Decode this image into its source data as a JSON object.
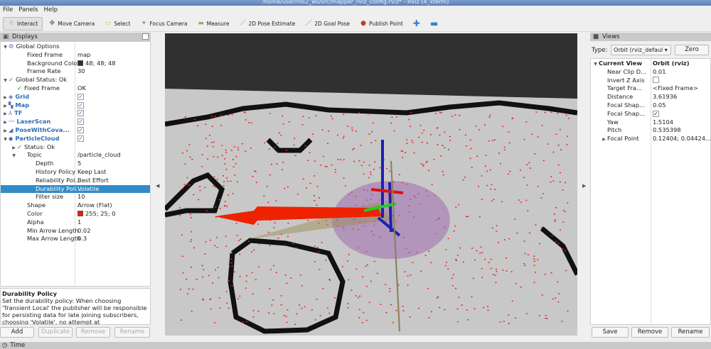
{
  "window": {
    "title": "/home/user/ros2_ws/src/mapper_rviz_config.rviz* - RViz (4_xterm)"
  },
  "menu": [
    "File",
    "Panels",
    "Help"
  ],
  "toolbar": [
    {
      "label": "Interact",
      "icon": "interact-icon",
      "active": true
    },
    {
      "label": "Move Camera",
      "icon": "move-camera-icon"
    },
    {
      "label": "Select",
      "icon": "select-icon"
    },
    {
      "label": "Focus Camera",
      "icon": "focus-camera-icon"
    },
    {
      "label": "Measure",
      "icon": "measure-icon"
    },
    {
      "label": "2D Pose Estimate",
      "icon": "pose-estimate-icon"
    },
    {
      "label": "2D Goal Pose",
      "icon": "goal-pose-icon"
    },
    {
      "label": "Publish Point",
      "icon": "publish-point-icon"
    }
  ],
  "displays": {
    "title": "Displays",
    "rows": [
      {
        "k": "Global Options",
        "v": "",
        "indent": 0,
        "arrow": "▼",
        "icon": "⚙"
      },
      {
        "k": "Fixed Frame",
        "v": "map",
        "indent": 1
      },
      {
        "k": "Background Color",
        "v": "48; 48; 48",
        "indent": 1,
        "swatch": "#303030"
      },
      {
        "k": "Frame Rate",
        "v": "30",
        "indent": 1
      },
      {
        "k": "Global Status: Ok",
        "v": "",
        "indent": 0,
        "arrow": "▼",
        "icon": "✓"
      },
      {
        "k": "Fixed Frame",
        "v": "OK",
        "indent": 1,
        "icon": "✓"
      },
      {
        "k": "Grid",
        "v": "✓",
        "indent": 0,
        "arrow": "▶",
        "icon": "◈",
        "blue": true
      },
      {
        "k": "Map",
        "v": "✓",
        "indent": 0,
        "arrow": "▶",
        "icon": "▚",
        "blue": true
      },
      {
        "k": "TF",
        "v": "✓",
        "indent": 0,
        "arrow": "▶",
        "icon": "⅄",
        "blue": true
      },
      {
        "k": "LaserScan",
        "v": "✓",
        "indent": 0,
        "arrow": "▶",
        "icon": "〰",
        "blue": true
      },
      {
        "k": "PoseWithCova...",
        "v": "✓",
        "indent": 0,
        "arrow": "▶",
        "icon": "◢",
        "blue": true
      },
      {
        "k": "ParticleCloud",
        "v": "✓",
        "indent": 0,
        "arrow": "▼",
        "icon": "◆",
        "blue": true
      },
      {
        "k": "Status: Ok",
        "v": "",
        "indent": 1,
        "arrow": "▶",
        "icon": "✓"
      },
      {
        "k": "Topic",
        "v": "/particle_cloud",
        "indent": 1,
        "arrow": "▼"
      },
      {
        "k": "Depth",
        "v": "5",
        "indent": 2
      },
      {
        "k": "History Policy",
        "v": "Keep Last",
        "indent": 2
      },
      {
        "k": "Reliability Pol...",
        "v": "Best Effort",
        "indent": 2
      },
      {
        "k": "Durability Poli...",
        "v": "Volatile",
        "indent": 2,
        "selected": true
      },
      {
        "k": "Filter size",
        "v": "10",
        "indent": 2
      },
      {
        "k": "Shape",
        "v": "Arrow (Flat)",
        "indent": 1
      },
      {
        "k": "Color",
        "v": "255; 25; 0",
        "indent": 1,
        "swatch": "#ff1900"
      },
      {
        "k": "Alpha",
        "v": "1",
        "indent": 1
      },
      {
        "k": "Min Arrow Length",
        "v": "0.02",
        "indent": 1
      },
      {
        "k": "Max Arrow Length",
        "v": "0.3",
        "indent": 1
      }
    ],
    "description_title": "Durability Policy",
    "description": "Set the durability policy: When choosing 'Transient Local' the publisher will be responsible for persisting data for late joining subscribers, choosing 'Volatile', no attempt at",
    "buttons": [
      "Add",
      "Duplicate",
      "Remove",
      "Rename"
    ]
  },
  "views": {
    "title": "Views",
    "type_label": "Type:",
    "type_value": "Orbit (rviz_defaul",
    "zero_label": "Zero",
    "rows": [
      {
        "k": "Current View",
        "v": "Orbit (rviz)",
        "header": true
      },
      {
        "k": "Near Clip D...",
        "v": "0.01"
      },
      {
        "k": "Invert Z Axis",
        "v": "",
        "checkbox": true
      },
      {
        "k": "Target Fra...",
        "v": "<Fixed Frame>"
      },
      {
        "k": "Distance",
        "v": "3.61936"
      },
      {
        "k": "Focal Shap...",
        "v": "0.05"
      },
      {
        "k": "Focal Shap...",
        "v": "✓",
        "checkbox": true
      },
      {
        "k": "Yaw",
        "v": "1.5104"
      },
      {
        "k": "Pitch",
        "v": "0.535398"
      },
      {
        "k": "Focal Point",
        "v": "0.12404; 0.04424...",
        "arrow": true
      }
    ],
    "buttons": [
      "Save",
      "Remove",
      "Rename"
    ]
  },
  "time_panel": {
    "title": "Time"
  }
}
